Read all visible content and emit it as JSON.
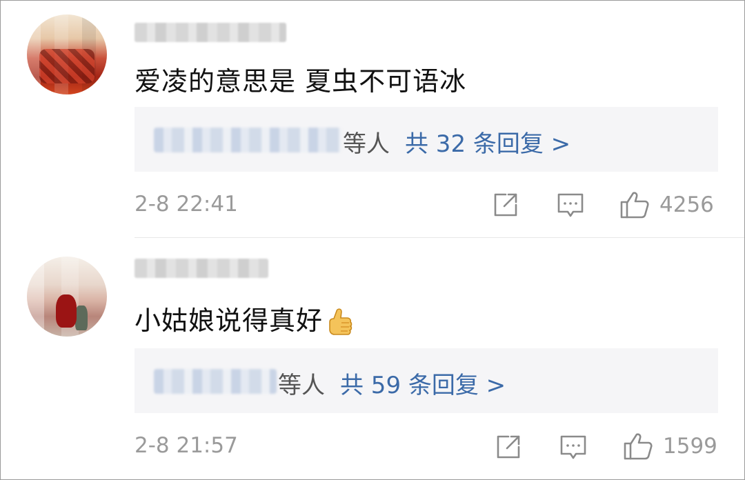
{
  "comments": [
    {
      "text": "爱凌的意思是 夏虫不可语冰",
      "reply_suffix": "等人",
      "reply_count": "共 32 条回复 >",
      "time": "2-8 22:41",
      "likes": "4256"
    },
    {
      "text": "小姑娘说得真好",
      "reply_suffix": "等人",
      "reply_count": "共 59 条回复 >",
      "time": "2-8 21:57",
      "likes": "1599"
    }
  ],
  "icons": {
    "share": "share-icon",
    "comment": "comment-icon",
    "like": "thumbs-up-icon",
    "emoji": "thumbs-up-emoji-icon"
  },
  "colors": {
    "link_blue": "#3b6aa8",
    "meta_gray": "#9a9a9a",
    "reply_bg": "#f5f5f7"
  }
}
